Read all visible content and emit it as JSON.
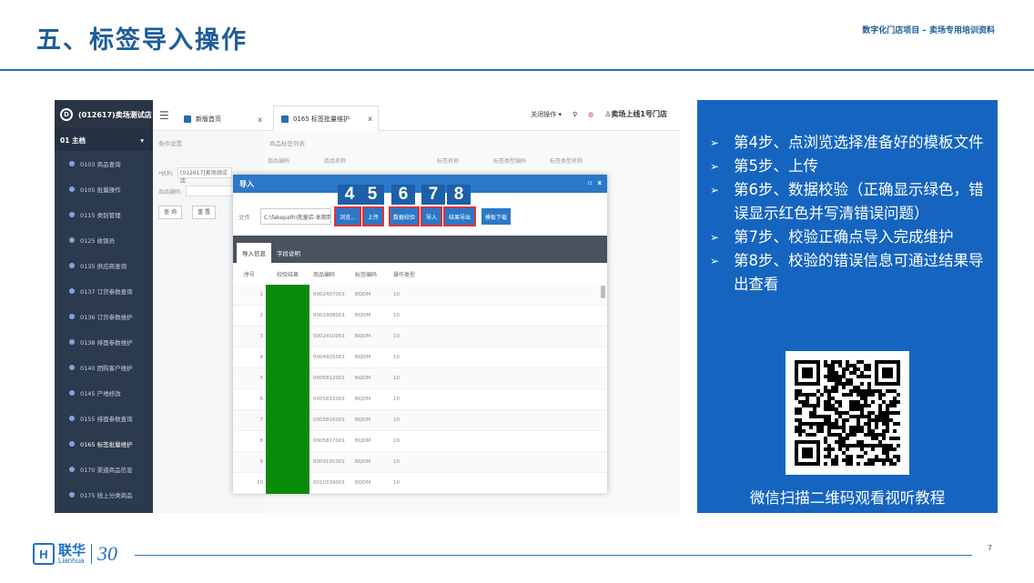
{
  "slide": {
    "title": "五、标签导入操作",
    "subtitle": "数字化门店项目 – 卖场专用培训资料",
    "page_number": "7",
    "logo_cn": "联华",
    "logo_en": "Lianhua",
    "logo_30": "30"
  },
  "app": {
    "company": "(012617)卖场测试店",
    "module": "01 主档",
    "sidebar_items": [
      "0103 商品查询",
      "0105 批量操作",
      "0115 类别管理",
      "0125 收银员",
      "0135 供应商查询",
      "0137 订货参数查询",
      "0136 订货参数维护",
      "0138 排面参数维护",
      "0140 团购客户维护",
      "0145 产地修改",
      "0155 排面参数查询",
      "0165 标签批量维护",
      "0170 渠道商品信息",
      "0175 线上分类商品"
    ],
    "tabs": [
      "新版首页",
      "0165 标签批量维护"
    ],
    "tab_close": "x",
    "topbar_right": {
      "ops": "关闭操作 ▾",
      "store": "卖场上线1号门店"
    },
    "filter_title": "条件设置",
    "filter_org_label": "*机构:",
    "filter_org_value": "[012617]卖场测试店",
    "filter_code_label": "商品编码:",
    "filter_btns": [
      "查 询",
      "重 置"
    ],
    "list_title": "商品标签列表",
    "list_columns": [
      "商品编码",
      "商品名称",
      "",
      "标签名称",
      "标签类型编码",
      "标签类型名称"
    ]
  },
  "modal": {
    "title": "导入",
    "file_label": "文件",
    "file_value": "C:\\fakepath\\批量店-本期到",
    "buttons": [
      {
        "num": "4",
        "label": "浏览..."
      },
      {
        "num": "5",
        "label": "上传"
      },
      {
        "num": "6",
        "label": "数据校验"
      },
      {
        "num": "7",
        "label": "导入"
      },
      {
        "num": "8",
        "label": "结果导出"
      }
    ],
    "template_btn": "模板下载",
    "tabs": [
      "导入信息",
      "字段说明"
    ],
    "columns": [
      "序号",
      "校验结果",
      "商品编码",
      "标签编码",
      "操作类型"
    ],
    "rows": [
      {
        "seq": "1",
        "code": "0002407001",
        "tag": "BQDM",
        "op": "10"
      },
      {
        "seq": "2",
        "code": "0002408001",
        "tag": "BQDM",
        "op": "10"
      },
      {
        "seq": "3",
        "code": "0002410001",
        "tag": "BQDM",
        "op": "10"
      },
      {
        "seq": "4",
        "code": "0004925001",
        "tag": "BQDM",
        "op": "10"
      },
      {
        "seq": "5",
        "code": "0005812001",
        "tag": "BQDM",
        "op": "10"
      },
      {
        "seq": "6",
        "code": "0005815001",
        "tag": "BQDM",
        "op": "10"
      },
      {
        "seq": "7",
        "code": "0005816001",
        "tag": "BQDM",
        "op": "10"
      },
      {
        "seq": "8",
        "code": "0005817001",
        "tag": "BQDM",
        "op": "10"
      },
      {
        "seq": "9",
        "code": "0009191001",
        "tag": "BQDM",
        "op": "10"
      },
      {
        "seq": "10",
        "code": "0010339001",
        "tag": "BQDM",
        "op": "10"
      }
    ]
  },
  "info": {
    "steps": [
      "第4步、点浏览选择准备好的模板文件",
      "第5步、上传",
      "第6步、数据校验（正确显示绿色，错误显示红色并写清错误问题）",
      "第7步、校验正确点导入完成维护",
      "第8步、校验的错误信息可通过结果导出查看"
    ],
    "qr_caption": "微信扫描二维码观看视听教程"
  },
  "colors": {
    "brand_blue": "#1f5c99",
    "panel_blue": "#1565c0",
    "ok_green": "#0a8a0a",
    "highlight_red": "#e03434"
  }
}
